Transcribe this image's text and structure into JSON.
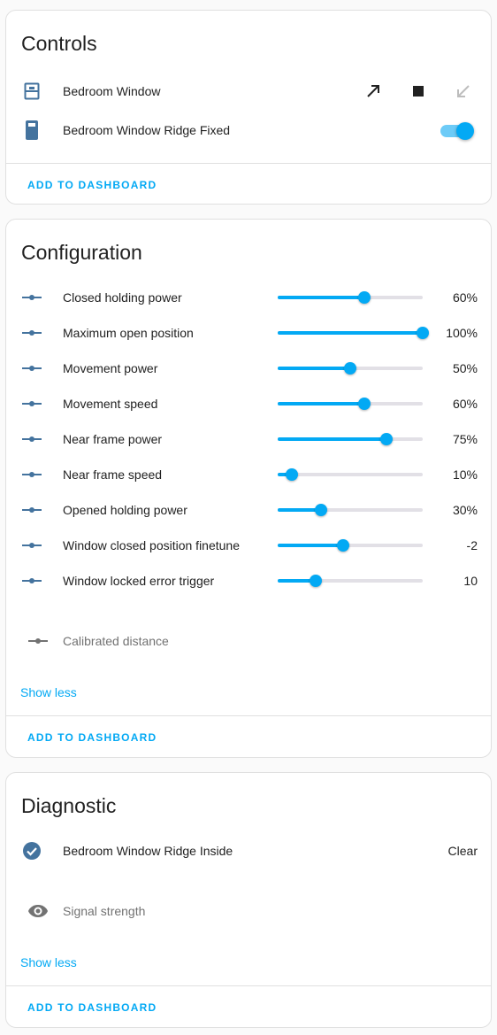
{
  "colors": {
    "accent": "#03a9f4",
    "icon": "#44739e",
    "muted_icon": "#727272"
  },
  "controls": {
    "title": "Controls",
    "items": [
      {
        "label": "Bedroom Window",
        "icon": "window-shutter-icon",
        "actions": [
          "open-arrow-icon",
          "stop-icon",
          "close-arrow-icon"
        ],
        "close_disabled": true
      },
      {
        "label": "Bedroom Window Ridge Fixed",
        "icon": "door-closed-icon",
        "toggle_on": true
      }
    ],
    "add_to_dashboard": "ADD TO DASHBOARD"
  },
  "configuration": {
    "title": "Configuration",
    "items": [
      {
        "label": "Closed holding power",
        "value": "60%",
        "fraction": 0.6
      },
      {
        "label": "Maximum open position",
        "value": "100%",
        "fraction": 1.0
      },
      {
        "label": "Movement power",
        "value": "50%",
        "fraction": 0.5
      },
      {
        "label": "Movement speed",
        "value": "60%",
        "fraction": 0.6
      },
      {
        "label": "Near frame power",
        "value": "75%",
        "fraction": 0.75
      },
      {
        "label": "Near frame speed",
        "value": "10%",
        "fraction": 0.1
      },
      {
        "label": "Opened holding power",
        "value": "30%",
        "fraction": 0.3
      },
      {
        "label": "Window closed position finetune",
        "value": "-2",
        "fraction": 0.45
      },
      {
        "label": "Window locked error trigger",
        "value": "10",
        "fraction": 0.26
      }
    ],
    "hidden_item": {
      "label": "Calibrated distance"
    },
    "show_less": "Show less",
    "add_to_dashboard": "ADD TO DASHBOARD"
  },
  "diagnostic": {
    "title": "Diagnostic",
    "items": [
      {
        "label": "Bedroom Window Ridge Inside",
        "value": "Clear",
        "icon": "check-circle-icon"
      }
    ],
    "hidden_item": {
      "label": "Signal strength",
      "icon": "eye-icon"
    },
    "show_less": "Show less",
    "add_to_dashboard": "ADD TO DASHBOARD"
  }
}
